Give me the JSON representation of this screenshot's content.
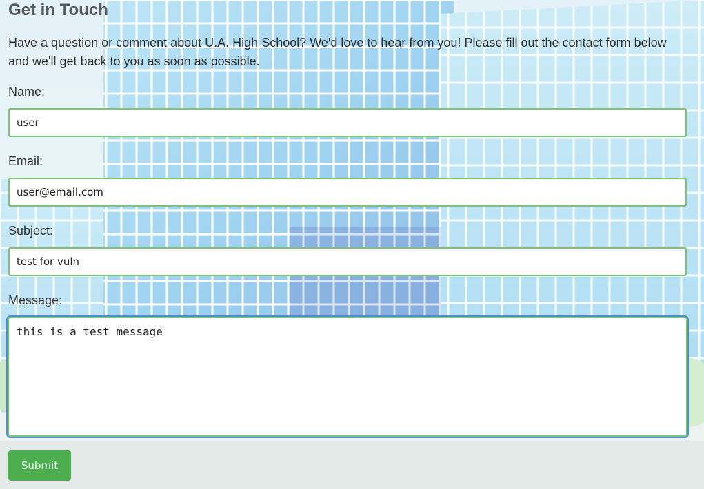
{
  "page": {
    "title": "Get in Touch",
    "intro": "Have a question or comment about U.A. High School? We'd love to hear from you! Please fill out the contact form below and we'll get back to you as soon as possible."
  },
  "form": {
    "name_label": "Name:",
    "name_value": "user",
    "email_label": "Email:",
    "email_value": "user@email.com",
    "subject_label": "Subject:",
    "subject_value": "test for vuln",
    "message_label": "Message:",
    "message_value": "this is a test message",
    "submit_label": "Submit"
  },
  "colors": {
    "input_border": "#7cc576",
    "focus_ring": "#4c8fd6",
    "submit_bg": "#4cae4f",
    "title_text": "#555a5e"
  }
}
